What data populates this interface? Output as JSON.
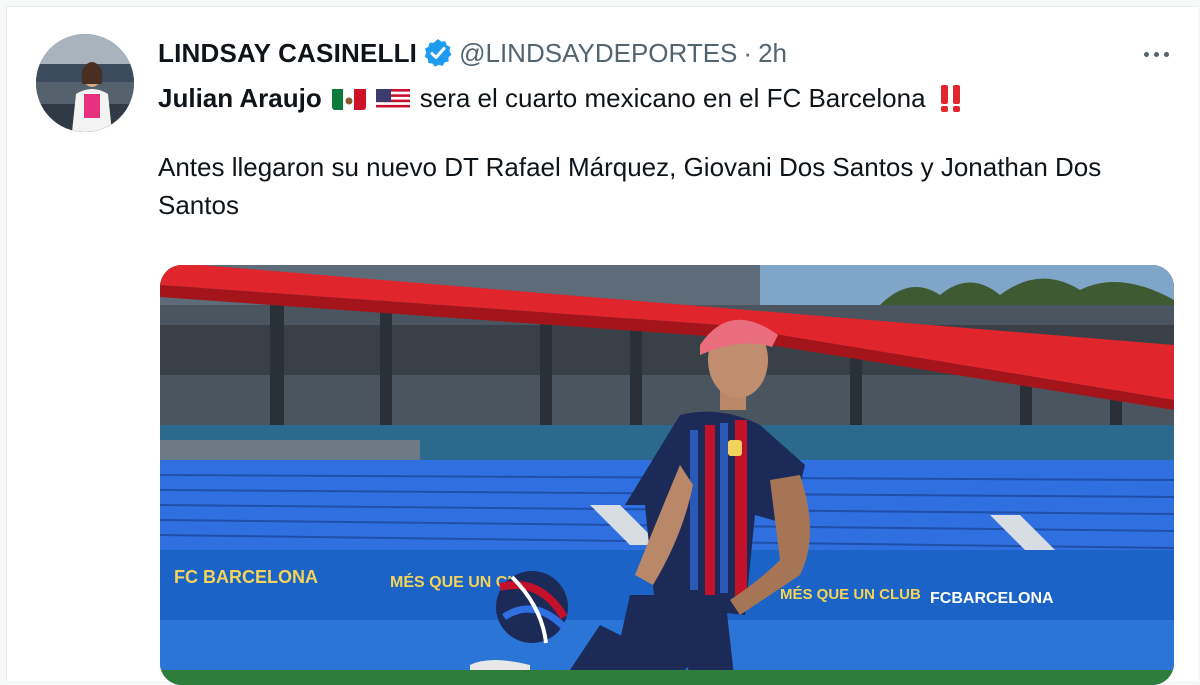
{
  "tweet": {
    "author_name": "LINDSAY CASINELLI",
    "handle": "@LINDSAYDEPORTES",
    "separator": "·",
    "time": "2h",
    "line1_bold": "Julian Araujo",
    "line1_text": "sera el cuarto mexicano en el FC Barcelona",
    "paragraph": "Antes llegaron su nuevo DT Rafael Márquez, Giovani Dos Santos y Jonathan Dos Santos"
  },
  "media": {
    "banner_left": "FC BARCELONA",
    "banner_mid": "MÉS QUE UN CLUB",
    "banner_mid2": "MÉS QUE UN CLUB",
    "banner_right": "FCBARCELONA"
  },
  "colors": {
    "verified": "#1d9bf0",
    "roof_red": "#e0252d",
    "seats_blue": "#2f6fe0",
    "banner_blue": "#1b63c6",
    "jersey_navy": "#1b2a57",
    "jersey_red": "#c3112a",
    "hair_pink": "#e96d7c"
  },
  "icons": [
    "verified-badge-icon",
    "more-options-icon",
    "mexico-flag-icon",
    "us-flag-icon",
    "double-exclamation-icon"
  ]
}
